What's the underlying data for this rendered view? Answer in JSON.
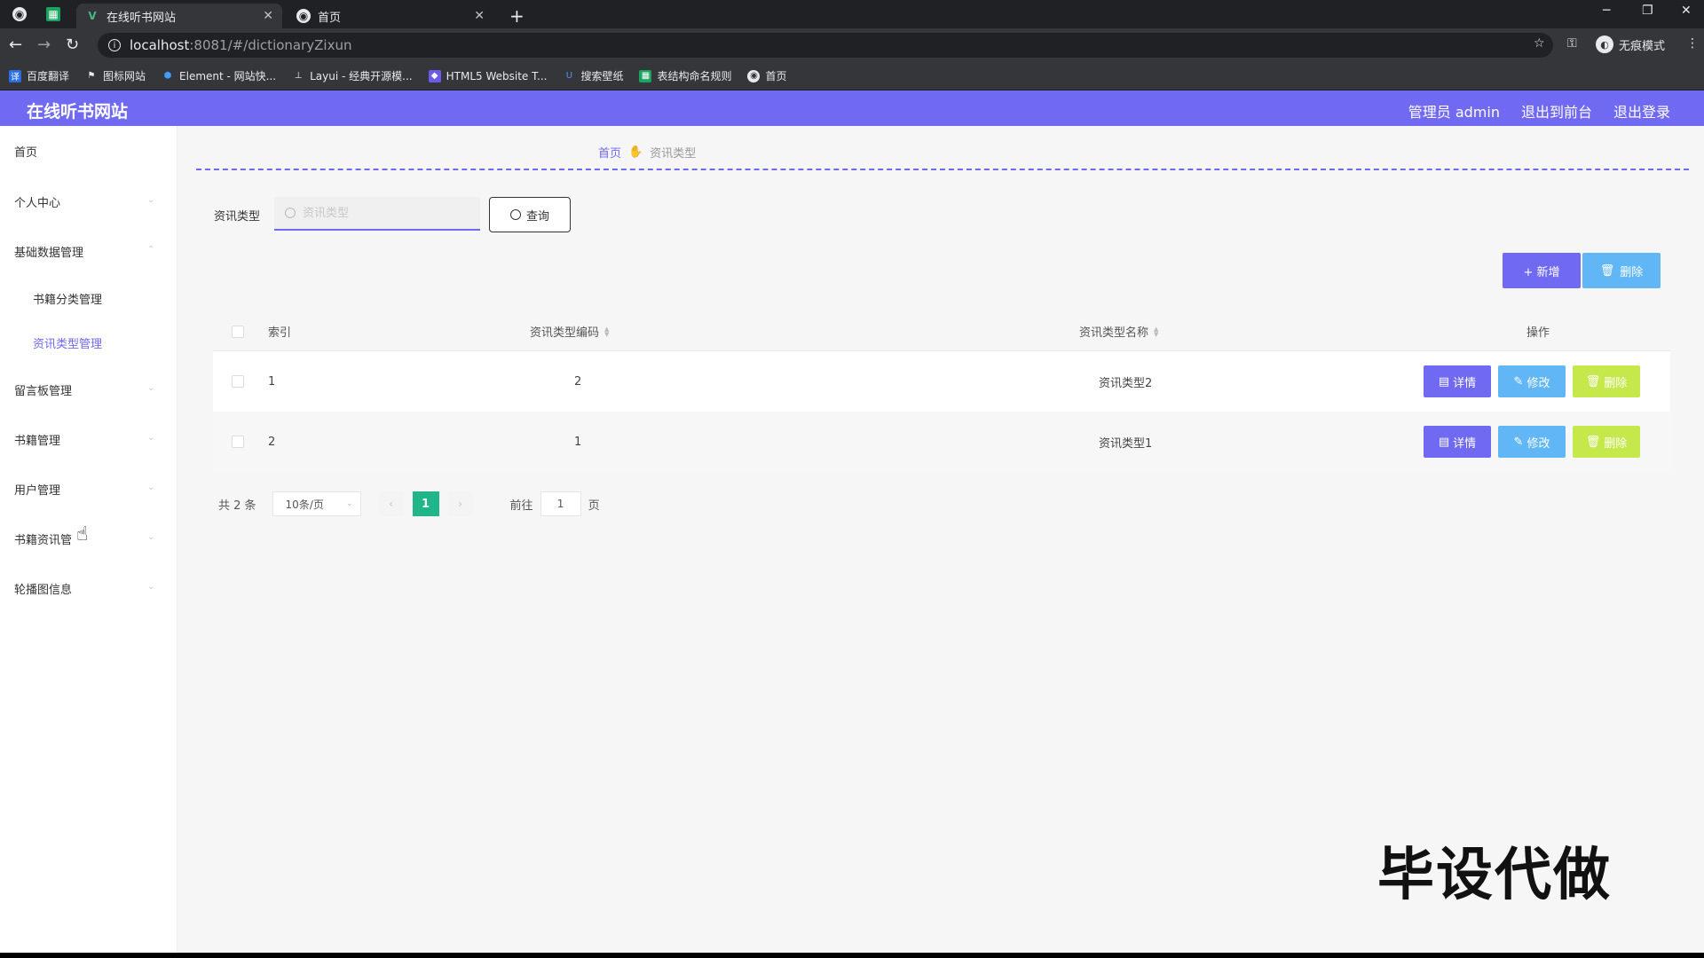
{
  "browser": {
    "tabs": [
      {
        "title": "在线听书网站",
        "active": true
      },
      {
        "title": "首页",
        "active": false
      }
    ],
    "new_tab": "+",
    "url_host": "localhost",
    "url_path": ":8081/#/dictionaryZixun",
    "incognito_label": "无痕模式",
    "bookmarks": [
      "百度翻译",
      "图标网站",
      "Element - 网站快...",
      "Layui - 经典开源模...",
      "HTML5 Website T...",
      "搜索壁纸",
      "表结构命名规则",
      "首页"
    ]
  },
  "header": {
    "title": "在线听书网站",
    "user": "管理员 admin",
    "to_front": "退出到前台",
    "logout": "退出登录",
    "accent": "#7069f1"
  },
  "sidebar": {
    "items": [
      "首页",
      "个人中心",
      "基础数据管理",
      "留言板管理",
      "书籍管理",
      "用户管理",
      "书籍资讯管",
      "轮播图信息"
    ],
    "sub_items": [
      "书籍分类管理",
      "资讯类型管理"
    ],
    "active_sub": "资讯类型管理"
  },
  "breadcrumb": {
    "home": "首页",
    "current": "资讯类型"
  },
  "search": {
    "label": "资讯类型",
    "placeholder": "资讯类型",
    "value": "",
    "button": "查询"
  },
  "actions": {
    "add": "+ 新增",
    "delete": "删除"
  },
  "table": {
    "headers": {
      "index": "索引",
      "code": "资讯类型编码",
      "name": "资讯类型名称",
      "ops": "操作"
    },
    "rows": [
      {
        "index": "1",
        "code": "2",
        "name": "资讯类型2"
      },
      {
        "index": "2",
        "code": "1",
        "name": "资讯类型1"
      }
    ],
    "row_buttons": {
      "detail": "详情",
      "edit": "修改",
      "delete": "删除"
    }
  },
  "pagination": {
    "total": "共 2 条",
    "page_size": "10条/页",
    "current_page": "1",
    "goto_label": "前往",
    "goto_value": "1",
    "goto_suffix": "页"
  },
  "watermark": "毕设代做"
}
